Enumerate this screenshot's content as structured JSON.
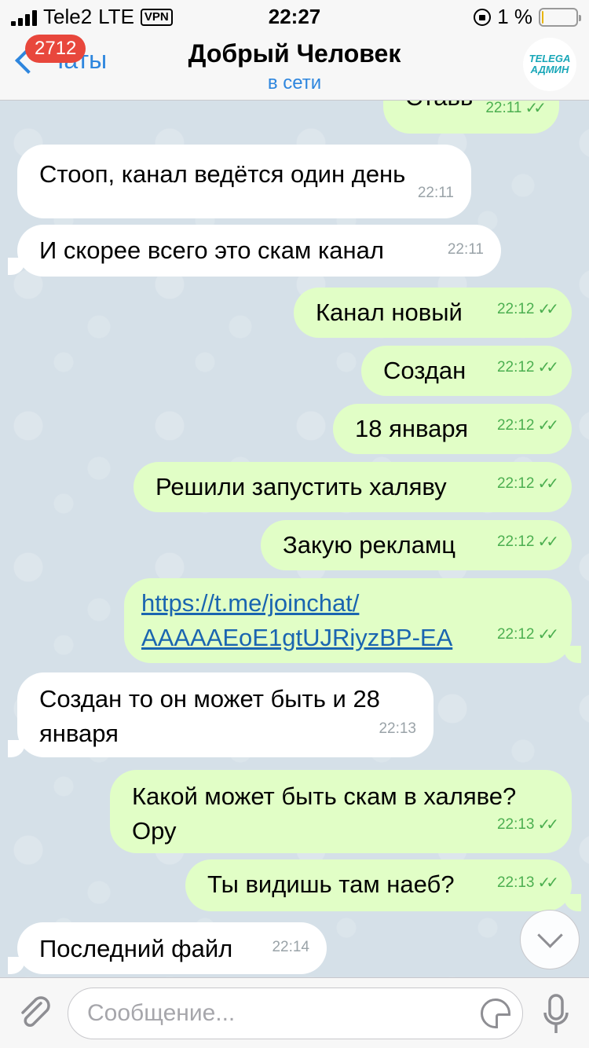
{
  "status_bar": {
    "carrier": "Tele2",
    "network": "LTE",
    "vpn": "VPN",
    "time": "22:27",
    "battery_percent": "1 %",
    "battery_level": 0.04
  },
  "nav": {
    "back_label": "Чаты",
    "unread_count": "2712",
    "title": "Добрый Человек",
    "status": "в сети",
    "avatar_line1": "TELEGA",
    "avatar_line2": "АДМИН"
  },
  "messages": [
    {
      "dir": "out",
      "text": "Ставь",
      "time": "22:11"
    },
    {
      "dir": "in",
      "text": "Стооп, канал ведётся один день",
      "time": "22:11"
    },
    {
      "dir": "in",
      "text": "И скорее всего это скам канал",
      "time": "22:11"
    },
    {
      "dir": "out",
      "text": "Канал новый",
      "time": "22:12"
    },
    {
      "dir": "out",
      "text": "Создан",
      "time": "22:12"
    },
    {
      "dir": "out",
      "text": "18 января",
      "time": "22:12"
    },
    {
      "dir": "out",
      "text": "Решили запустить халяву",
      "time": "22:12"
    },
    {
      "dir": "out",
      "text": "Закую рекламц",
      "time": "22:12"
    },
    {
      "dir": "out",
      "link_line1": "https://t.me/joinchat/",
      "link_line2": "AAAAAEoE1gtUJRiyzBP-EA",
      "time": "22:12"
    },
    {
      "dir": "in",
      "text_line1": "Создан то он может быть и 28",
      "text_line2": "января",
      "time": "22:13"
    },
    {
      "dir": "out",
      "text_line1": "Какой может быть скам в халяве?",
      "text_line2": "Ору",
      "time": "22:13"
    },
    {
      "dir": "out",
      "text": "Ты видишь там наеб?",
      "time": "22:13"
    },
    {
      "dir": "in",
      "text": "Последний файл",
      "time": "22:14"
    }
  ],
  "input": {
    "placeholder": "Сообщение..."
  },
  "colors": {
    "accent": "#2e86de",
    "outgoing_bubble": "#e1fec6",
    "incoming_bubble": "#ffffff",
    "badge": "#e8473c",
    "read_check": "#4caf50"
  },
  "icons": {
    "attach": "paperclip-icon",
    "sticker": "sticker-icon",
    "mic": "microphone-icon",
    "scroll": "chevron-down-icon"
  }
}
